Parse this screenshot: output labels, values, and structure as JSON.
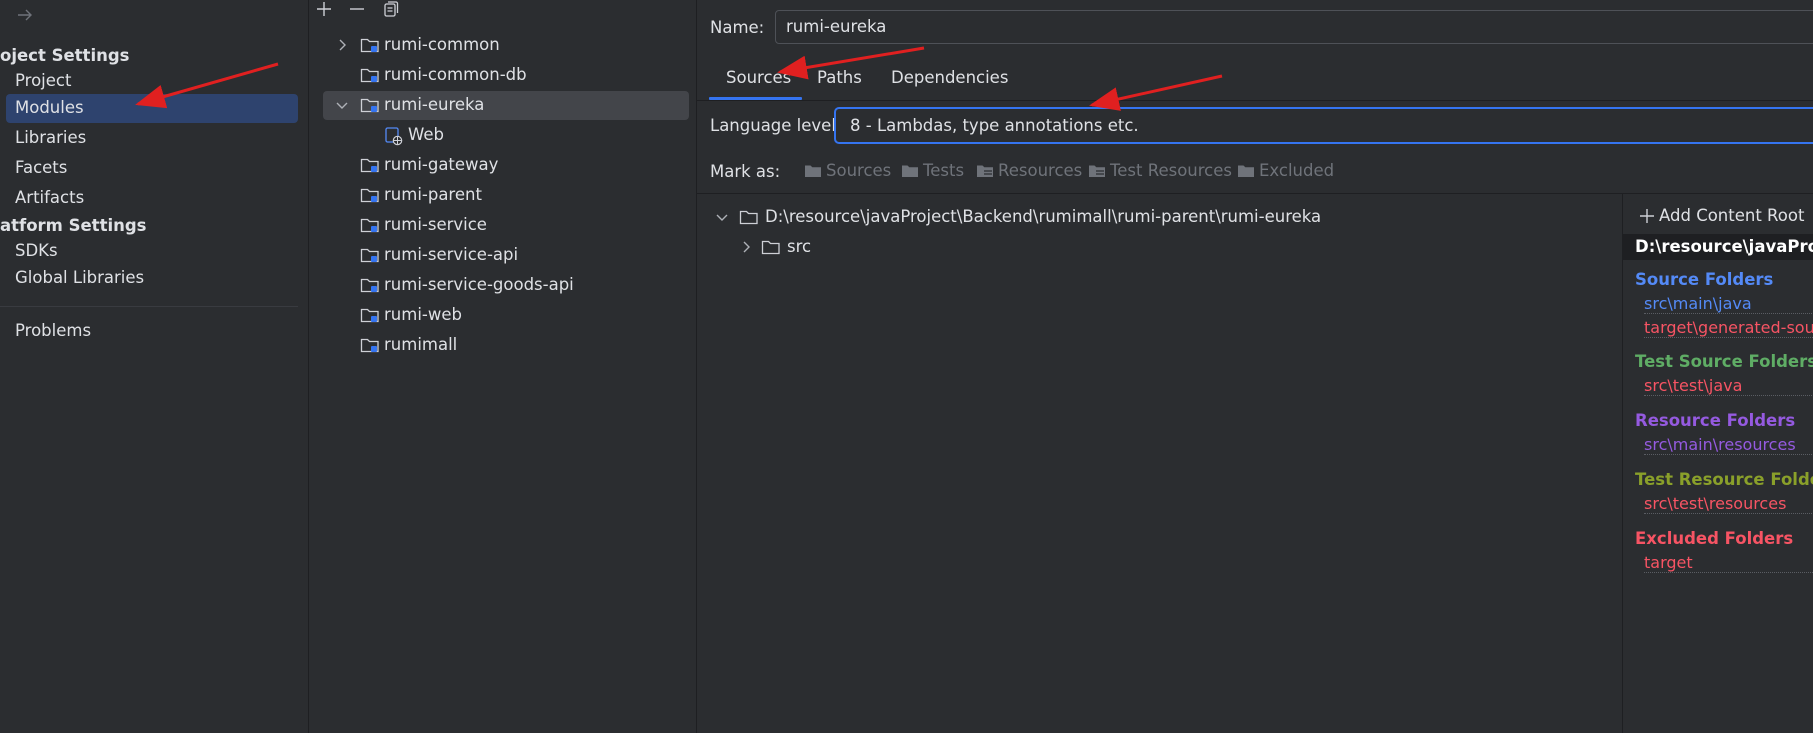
{
  "window": {
    "back_icon": "arrow-right-icon"
  },
  "settings_nav": {
    "project_settings_header": "oject Settings",
    "platform_settings_header": "atform Settings",
    "items": [
      {
        "label": "Project"
      },
      {
        "label": "Modules",
        "selected": true
      },
      {
        "label": "Libraries"
      },
      {
        "label": "Facets"
      },
      {
        "label": "Artifacts"
      }
    ],
    "platform_items": [
      {
        "label": "SDKs"
      },
      {
        "label": "Global Libraries"
      }
    ],
    "problems": "Problems"
  },
  "module_tree": {
    "toolbar": [
      "plus-icon",
      "minus-icon",
      "copy-icon"
    ],
    "rows": [
      {
        "label": "rumi-common",
        "expandable": true
      },
      {
        "label": "rumi-common-db"
      },
      {
        "label": "rumi-eureka",
        "expanded": true,
        "selected": true
      },
      {
        "label": "Web",
        "facet": true
      },
      {
        "label": "rumi-gateway"
      },
      {
        "label": "rumi-parent"
      },
      {
        "label": "rumi-service"
      },
      {
        "label": "rumi-service-api"
      },
      {
        "label": "rumi-service-goods-api"
      },
      {
        "label": "rumi-web"
      },
      {
        "label": "rumimall"
      }
    ]
  },
  "module_details": {
    "name_label": "Name:",
    "name_value": "rumi-eureka",
    "tabs": [
      {
        "label": "Sources",
        "active": true
      },
      {
        "label": "Paths"
      },
      {
        "label": "Dependencies"
      }
    ],
    "language_level_label": "Language level:",
    "language_level_value": "8 - Lambdas, type annotations etc.",
    "mark_as_label": "Mark as:",
    "mark_as": [
      "Sources",
      "Tests",
      "Resources",
      "Test Resources",
      "Excluded"
    ],
    "content_tree": {
      "root": "D:\\resource\\javaProject\\Backend\\rumimall\\rumi-parent\\rumi-eureka",
      "children": [
        "src"
      ]
    },
    "roots_pane": {
      "add_content_root": "Add Content Root",
      "root_path": "D:\\resource\\javaProje",
      "groups": [
        {
          "title": "Source Folders",
          "title_color": "#548af7",
          "item_color": "#548af7",
          "items": [
            "src\\main\\java"
          ],
          "extra": "target\\generated-sour",
          "extra_color": "#f75464"
        },
        {
          "title": "Test Source Folders",
          "title_color": "#5fad65",
          "item_color": "#f75464",
          "items": [
            "src\\test\\java"
          ]
        },
        {
          "title": "Resource Folders",
          "title_color": "#955ae0",
          "item_color": "#955ae0",
          "items": [
            "src\\main\\resources"
          ]
        },
        {
          "title": "Test Resource Folders",
          "title_color": "#8aa02a",
          "item_color": "#f75464",
          "items": [
            "src\\test\\resources"
          ]
        },
        {
          "title": "Excluded Folders",
          "title_color": "#f75464",
          "item_color": "#f75464",
          "items": [
            "target"
          ]
        }
      ]
    }
  },
  "colors": {
    "background": "#2b2d30",
    "selection": "#2e436e",
    "focus": "#3574f0",
    "annotation_arrow": "#e02020"
  }
}
